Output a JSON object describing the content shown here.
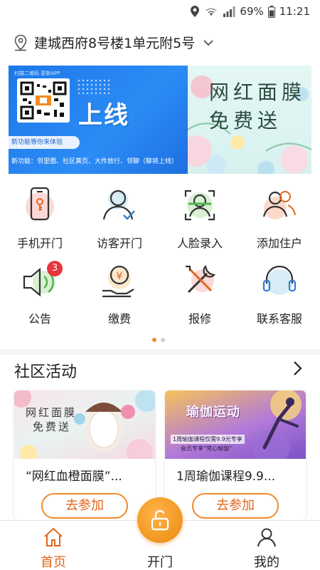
{
  "status_bar": {
    "battery": "69%",
    "time": "11:21"
  },
  "address": {
    "text": "建城西府8号楼1单元附5号"
  },
  "banner": {
    "top_tag": "扫描二维码 更新APP",
    "headline": "上线",
    "pill": "新功能等你来体验",
    "features": "新功能：邻里圈、社区黄页、大件放行、邻聊（聊将上线）",
    "right_line1": "网红面膜",
    "right_line2": "免费送"
  },
  "grid": [
    {
      "label": "手机开门",
      "icon": "phone-key-icon"
    },
    {
      "label": "访客开门",
      "icon": "visitor-icon"
    },
    {
      "label": "人脸录入",
      "icon": "face-scan-icon"
    },
    {
      "label": "添加住户",
      "icon": "add-resident-icon"
    },
    {
      "label": "公告",
      "icon": "speaker-icon",
      "badge": "3"
    },
    {
      "label": "缴费",
      "icon": "payment-icon"
    },
    {
      "label": "报修",
      "icon": "repair-icon"
    },
    {
      "label": "联系客服",
      "icon": "headset-icon"
    }
  ],
  "section": {
    "title": "社区活动"
  },
  "cards": [
    {
      "title": "“网红血橙面膜”...",
      "button": "去参加",
      "image_text1": "网红面膜",
      "image_text2": "免费送"
    },
    {
      "title": "1周瑜伽课程9.9...",
      "button": "去参加",
      "image_text1": "瑜伽运动",
      "image_text2": "1周瑜伽课程仅需9.9元专享",
      "image_text3": "会员专享“梵心瑜伽”"
    }
  ],
  "nav": {
    "home": "首页",
    "open": "开门",
    "mine": "我的"
  },
  "colors": {
    "accent": "#f08a2c",
    "badge": "#e8343a"
  }
}
